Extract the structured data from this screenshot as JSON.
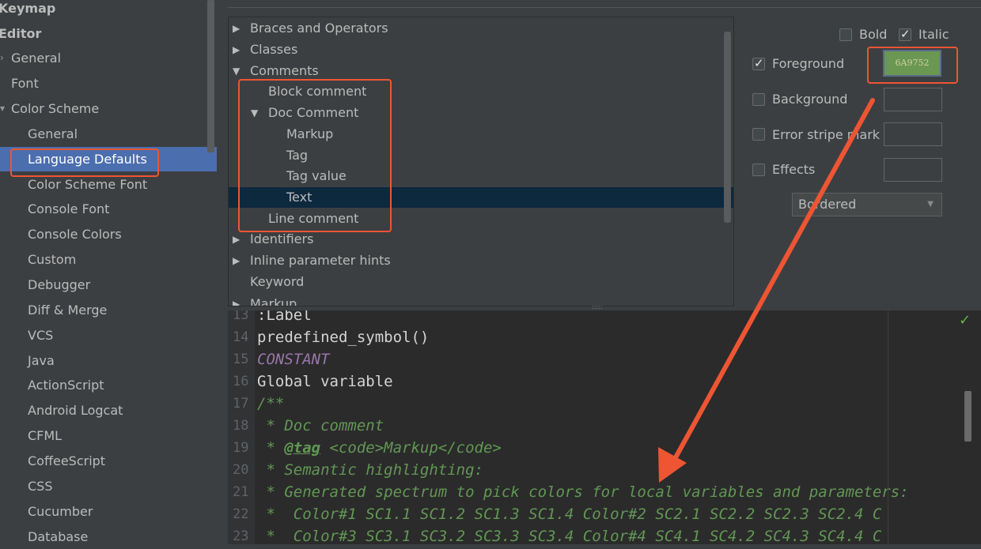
{
  "sidebar": {
    "items": [
      {
        "label": "Keymap"
      },
      {
        "label": "Editor"
      },
      {
        "label": "General"
      },
      {
        "label": "Font"
      },
      {
        "label": "Color Scheme"
      },
      {
        "label": "General"
      },
      {
        "label": "Language Defaults"
      },
      {
        "label": "Color Scheme Font"
      },
      {
        "label": "Console Font"
      },
      {
        "label": "Console Colors"
      },
      {
        "label": "Custom"
      },
      {
        "label": "Debugger"
      },
      {
        "label": "Diff & Merge"
      },
      {
        "label": "VCS"
      },
      {
        "label": "Java"
      },
      {
        "label": "ActionScript"
      },
      {
        "label": "Android Logcat"
      },
      {
        "label": "CFML"
      },
      {
        "label": "CoffeeScript"
      },
      {
        "label": "CSS"
      },
      {
        "label": "Cucumber"
      },
      {
        "label": "Database"
      }
    ],
    "selected": "Language Defaults"
  },
  "tree": {
    "items": [
      {
        "label": "Braces and Operators",
        "expander": "▶"
      },
      {
        "label": "Classes",
        "expander": "▶"
      },
      {
        "label": "Comments",
        "expander": "▼"
      },
      {
        "label": "Block comment"
      },
      {
        "label": "Doc Comment",
        "expander": "▼"
      },
      {
        "label": "Markup"
      },
      {
        "label": "Tag"
      },
      {
        "label": "Tag value"
      },
      {
        "label": "Text"
      },
      {
        "label": "Line comment"
      },
      {
        "label": "Identifiers",
        "expander": "▶"
      },
      {
        "label": "Inline parameter hints",
        "expander": "▶"
      },
      {
        "label": "Keyword"
      },
      {
        "label": "Markup",
        "expander": "▶"
      }
    ],
    "selected": "Text"
  },
  "attributes": {
    "bold": {
      "label": "Bold",
      "checked": false
    },
    "italic": {
      "label": "Italic",
      "checked": true
    },
    "foreground": {
      "label": "Foreground",
      "checked": true,
      "value": "6A9752",
      "color": "#6a9752"
    },
    "background": {
      "label": "Background",
      "checked": false
    },
    "error_stripe": {
      "label": "Error stripe mark",
      "checked": false
    },
    "effects": {
      "label": "Effects",
      "checked": false,
      "type": "Bordered"
    }
  },
  "editor": {
    "lines": [
      {
        "n": "13",
        "text": ":Label",
        "style": "plain"
      },
      {
        "n": "14",
        "text": "predefined_symbol()",
        "style": "plain"
      },
      {
        "n": "15",
        "text": "CONSTANT",
        "style": "const"
      },
      {
        "n": "16",
        "text": "Global variable",
        "style": "plain"
      },
      {
        "n": "17",
        "text": "/**",
        "style": "doc"
      },
      {
        "n": "18",
        "text": " * Doc comment",
        "style": "doc"
      },
      {
        "n": "19",
        "text_pre": " * ",
        "tag": "@tag",
        "text_post": " <code>Markup</code>",
        "style": "doc"
      },
      {
        "n": "20",
        "text": " * Semantic highlighting:",
        "style": "doc"
      },
      {
        "n": "21",
        "text": " * Generated spectrum to pick colors for local variables and parameters:",
        "style": "doc"
      },
      {
        "n": "22",
        "text": " *  Color#1 SC1.1 SC1.2 SC1.3 SC1.4 Color#2 SC2.1 SC2.2 SC2.3 SC2.4 C",
        "style": "doc"
      },
      {
        "n": "23",
        "text": " *  Color#3 SC3.1 SC3.2 SC3.3 SC3.4 Color#4 SC4.1 SC4.2 SC4.3 SC4.4 C",
        "style": "doc"
      }
    ]
  },
  "colors": {
    "selection": "#4b6eaf",
    "annotation": "#ee5533",
    "doc_comment": "#629755"
  },
  "icons": [
    "check-icon",
    "chevron-down-icon",
    "expand-triangle-icon",
    "collapse-triangle-icon"
  ]
}
